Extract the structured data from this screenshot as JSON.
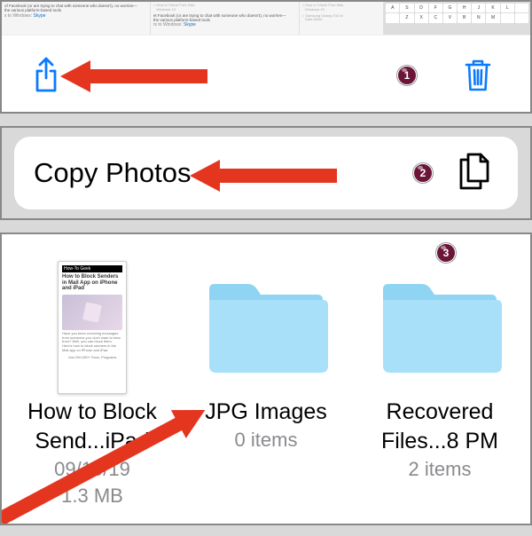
{
  "panel1": {
    "tabs": [
      {
        "textA": "of Facebook (or are trying to chat with someone who doesn't), no worries—",
        "textB": "the various platform-based tools",
        "link_prefix": "s to Windows:",
        "link": "Skype"
      },
      {
        "hint1": "How to Check Free Disk",
        "hint2": "Windows 10",
        "textA": "et Facebook (or are trying to chat with someone who doesn't), no worries—",
        "textB": "the various platform-based tools",
        "link_prefix": "rs to Windows:",
        "link": "Skype"
      },
      {
        "hint1": "How to Check Free Disk",
        "hint2": "Windows 10",
        "hint3": "Samsung Galaxy S10 in",
        "hint4": "Dark Mode"
      }
    ],
    "keys": [
      "A",
      "S",
      "D",
      "F",
      "G",
      "H",
      "J",
      "K",
      "L",
      "",
      "",
      "Z",
      "X",
      "C",
      "V",
      "B",
      "N",
      "M",
      "",
      ""
    ],
    "badge": "1"
  },
  "panel2": {
    "label": "Copy Photos",
    "badge": "2"
  },
  "panel3": {
    "badge": "3",
    "items": [
      {
        "thumb_header": "How-To Geek",
        "thumb_title": "How to Block Senders in Mail App on iPhone and iPad",
        "thumb_body": "Have you been receiving messages from someone you don't want to hear from? Well, you can block them. Here's how to block senders in the Mail app on iPhone and iPad.",
        "thumb_footer": "Join 250,000+ Fans, Programs",
        "title_l1": "How to Block",
        "title_l2": "Send...iPad",
        "sub1": "09/10/19",
        "sub2": "1.3 MB"
      },
      {
        "title_l1": "JPG Images",
        "sub1": "0 items"
      },
      {
        "title_l1": "Recovered",
        "title_l2": "Files...8 PM",
        "sub1": "2 items"
      }
    ]
  }
}
